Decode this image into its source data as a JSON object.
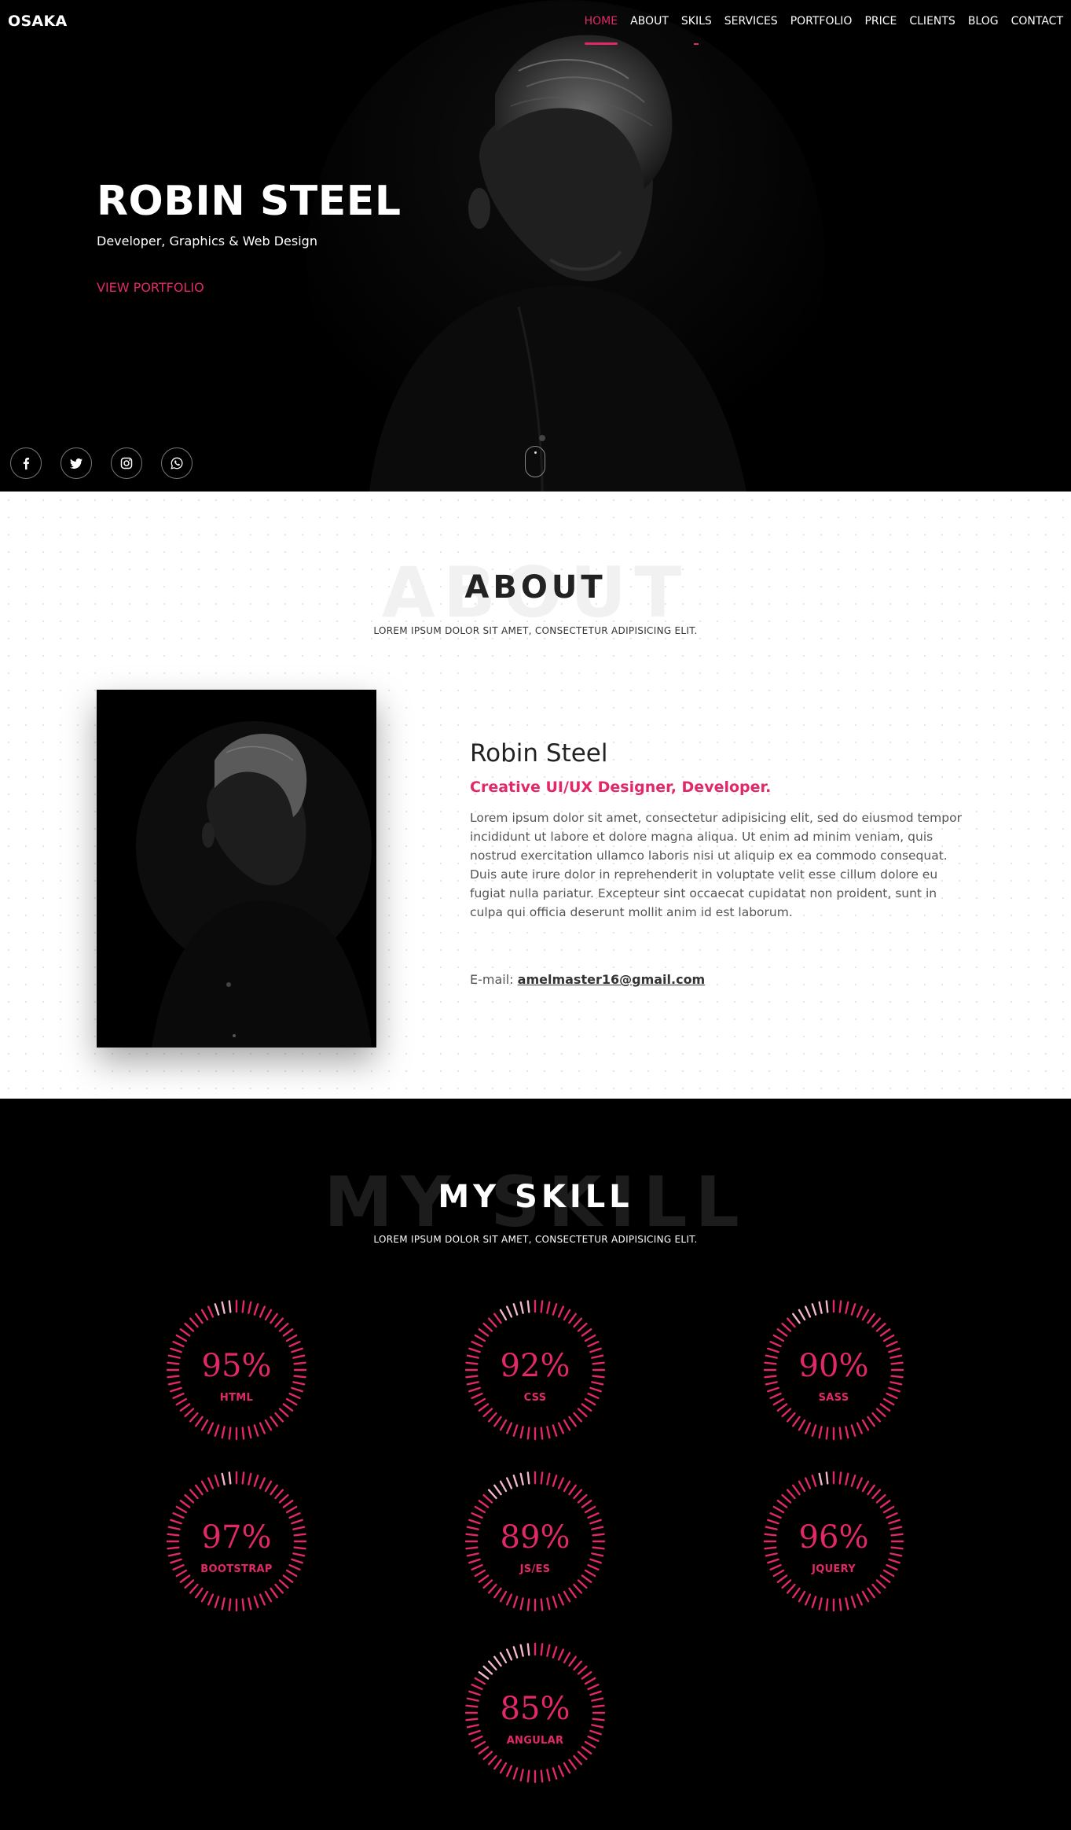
{
  "brand": "OSAKA",
  "nav": [
    "HOME",
    "ABOUT",
    "SKILS",
    "SERVICES",
    "PORTFOLIO",
    "PRICE",
    "CLIENTS",
    "BLOG",
    "CONTACT"
  ],
  "hero": {
    "name": "ROBIN STEEL",
    "subtitle": "Developer, Graphics & Web Design",
    "cta": "VIEW PORTFOLIO",
    "socials": [
      "facebook-icon",
      "twitter-icon",
      "instagram-icon",
      "whatsapp-icon"
    ]
  },
  "about": {
    "ghost": "ABOUT",
    "title": "ABOUT",
    "subtitle": "LOREM IPSUM DOLOR SIT AMET, CONSECTETUR ADIPISICING ELIT.",
    "name": "Robin Steel",
    "role": "Creative UI/UX Designer, Developer.",
    "bio": "Lorem ipsum dolor sit amet, consectetur adipisicing elit, sed do eiusmod tempor incididunt ut labore et dolore magna aliqua. Ut enim ad minim veniam, quis nostrud exercitation ullamco laboris nisi ut aliquip ex ea commodo consequat. Duis aute irure dolor in reprehenderit in voluptate velit esse cillum dolore eu fugiat nulla pariatur. Excepteur sint occaecat cupidatat non proident, sunt in culpa qui officia deserunt mollit anim id est laborum.",
    "email_label": "E-mail:",
    "email": "amelmaster16@gmail.com"
  },
  "skills": {
    "ghost": "MY SKILL",
    "title": "MY SKILL",
    "subtitle": "LOREM IPSUM DOLOR SIT AMET, CONSECTETUR ADIPISICING ELIT.",
    "items": [
      {
        "value": "95%",
        "label": "HTML",
        "pct": 95
      },
      {
        "value": "92%",
        "label": "CSS",
        "pct": 92
      },
      {
        "value": "90%",
        "label": "SASS",
        "pct": 90
      },
      {
        "value": "97%",
        "label": "BOOTSTRAP",
        "pct": 97
      },
      {
        "value": "89%",
        "label": "JS/ES",
        "pct": 89
      },
      {
        "value": "96%",
        "label": "JQUERY",
        "pct": 96
      },
      {
        "value": "85%",
        "label": "ANGULAR",
        "pct": 85
      }
    ]
  },
  "colors": {
    "accent": "#e3286a",
    "dark": "#000000",
    "light": "#ffffff"
  }
}
